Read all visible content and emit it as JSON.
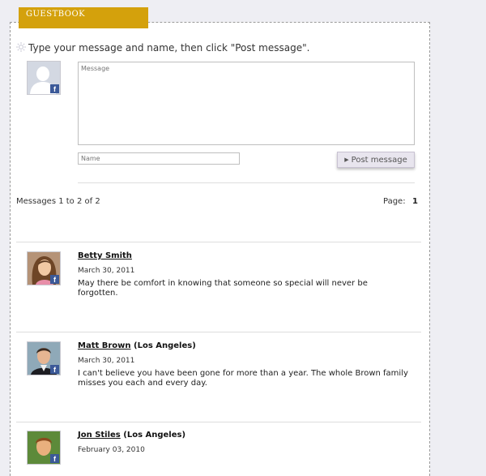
{
  "tab": {
    "label": "GUESTBOOK"
  },
  "instructions": "Type your message and name, then click \"Post message\".",
  "form": {
    "message_placeholder": "Message",
    "name_placeholder": "Name",
    "post_label": "Post message"
  },
  "pagination": {
    "count_text": "Messages 1 to 2 of 2",
    "page_label": "Page:",
    "page_number": "1"
  },
  "entries": [
    {
      "name": "Betty Smith",
      "location": "",
      "date": "March 30, 2011",
      "message": "May there be comfort in knowing that someone so special will never be forgotten."
    },
    {
      "name": "Matt Brown",
      "location": "(Los Angeles)",
      "date": "March 30, 2011",
      "message": "I can't believe you have been gone for more than a year. The whole Brown family misses you each and every day."
    },
    {
      "name": "Jon Stiles",
      "location": "(Los Angeles)",
      "date": "February 03, 2010",
      "message": ""
    }
  ],
  "icons": {
    "sun": "sun-icon",
    "facebook": "facebook-icon",
    "triangle": "play-triangle-icon"
  },
  "colors": {
    "tab": "#d4a10c",
    "facebook": "#3b5998",
    "background": "#eeeef3"
  }
}
